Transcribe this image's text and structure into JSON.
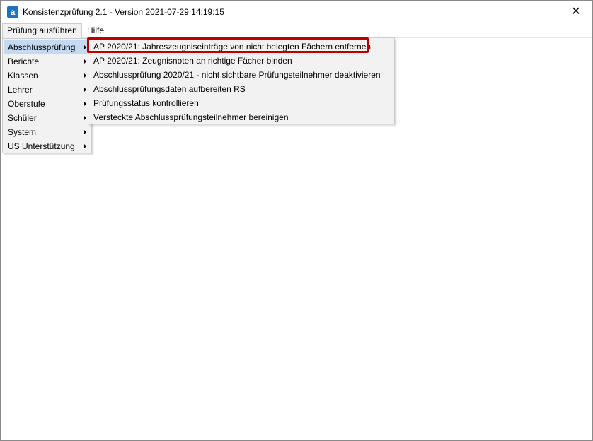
{
  "window": {
    "title": "Konsistenzprüfung 2.1 - Version 2021-07-29 14:19:15",
    "app_icon_glyph": "a",
    "close_glyph": "✕"
  },
  "menubar": {
    "items": [
      {
        "label": "Prüfung ausführen"
      },
      {
        "label": "Hilfe"
      }
    ]
  },
  "main_menu": {
    "items": [
      {
        "label": "Abschlussprüfung"
      },
      {
        "label": "Berichte"
      },
      {
        "label": "Klassen"
      },
      {
        "label": "Lehrer"
      },
      {
        "label": "Oberstufe"
      },
      {
        "label": "Schüler"
      },
      {
        "label": "System"
      },
      {
        "label": "US Unterstützung"
      }
    ]
  },
  "submenu": {
    "items": [
      {
        "label": "AP 2020/21: Jahreszeugniseinträge von nicht belegten Fächern entfernen"
      },
      {
        "label": "AP 2020/21: Zeugnisnoten an richtige Fächer binden"
      },
      {
        "label": "Abschlussprüfung 2020/21 - nicht sichtbare Prüfungsteilnehmer deaktivieren"
      },
      {
        "label": "Abschlussprüfungsdaten aufbereiten RS"
      },
      {
        "label": "Prüfungsstatus kontrollieren"
      },
      {
        "label": "Versteckte Abschlussprüfungsteilnehmer bereinigen"
      }
    ]
  },
  "colors": {
    "highlight_border": "#c00000",
    "hover_background": "#c4daf2",
    "menu_background": "#f2f2f2",
    "app_icon": "#1e73be"
  }
}
